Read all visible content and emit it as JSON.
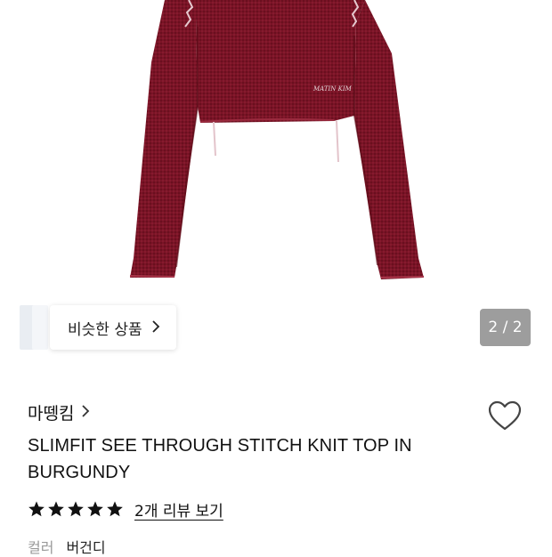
{
  "gallery": {
    "similar_label": "비슷한 상품",
    "similar_chevron": "chevron-right-icon",
    "page_counter": "2 / 2",
    "product_color": "#7a1426",
    "embroidery_text": "MATIN KIM"
  },
  "product": {
    "brand": "마뗑킴",
    "brand_chevron": "chevron-right-icon",
    "title": "SLIMFIT SEE THROUGH STITCH KNIT TOP IN BURGUNDY",
    "rating_stars": 5,
    "review_link": "2개 리뷰 보기",
    "option_label": "컬러",
    "option_value": "버건디",
    "wishlist_icon": "heart-outline-icon"
  }
}
